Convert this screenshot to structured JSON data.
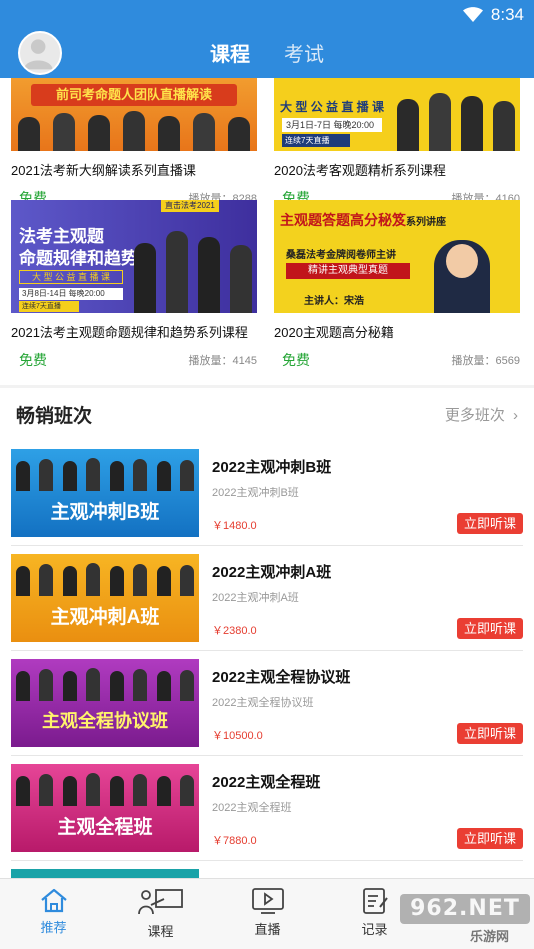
{
  "status": {
    "time": "8:34"
  },
  "header": {
    "tabs": [
      {
        "label": "课程",
        "active": true
      },
      {
        "label": "考试",
        "active": false
      }
    ]
  },
  "courses": [
    {
      "banner_text": "前司考命题人团队直播解读",
      "banner_sub": "",
      "title": "2021法考新大纲解读系列直播课",
      "price": "免费",
      "plays": "播放量：8288"
    },
    {
      "banner_text": "大 型 公 益 直 播 课",
      "banner_sub": "3月1日-7日 每晚20:00",
      "banner_sub2": "连续7天直播",
      "title": "2020法考客观题精析系列课程",
      "price": "免费",
      "plays": "播放量：4160"
    },
    {
      "banner_tag": "直击法考2021",
      "banner_text": "法考主观题",
      "banner_text2": "命题规律和趋势",
      "banner_sub": "大 型 公 益 直 播 课",
      "banner_date": "3月8日-14日 每晚20:00",
      "banner_date2": "连续7天直播",
      "title": "2021法考主观题命题规律和趋势系列课程",
      "price": "免费",
      "plays": "播放量：4145"
    },
    {
      "banner_text": "主观题答题高分秘笈",
      "banner_suffix": "系列讲座",
      "banner_sub": "桑磊法考金牌阅卷师主讲",
      "banner_sub2": "精讲主观典型真题",
      "banner_speaker": "主讲人：宋浩",
      "title": "2020主观题高分秘籍",
      "price": "免费",
      "plays": "播放量：6569"
    }
  ],
  "bestseller": {
    "title": "畅销班次",
    "more": "更多班次",
    "items": [
      {
        "banner": "主观冲刺B班",
        "title": "2022主观冲刺B班",
        "subtitle": "2022主观冲刺B班",
        "price": "￥1480.0",
        "button": "立即听课",
        "color": "#1f8fd6"
      },
      {
        "banner": "主观冲刺A班",
        "title": "2022主观冲刺A班",
        "subtitle": "2022主观冲刺A班",
        "price": "￥2380.0",
        "button": "立即听课",
        "color": "#f2a517"
      },
      {
        "banner": "主观全程协议班",
        "title": "2022主观全程协议班",
        "subtitle": "2022主观全程协议班",
        "price": "￥10500.0",
        "button": "立即听课",
        "color": "#9b2aa8"
      },
      {
        "banner": "主观全程班",
        "title": "2022主观全程班",
        "subtitle": "2022主观全程班",
        "price": "￥7880.0",
        "button": "立即听课",
        "color": "#d6287a"
      }
    ]
  },
  "nav": [
    {
      "label": "推荐",
      "icon": "home-icon",
      "active": true
    },
    {
      "label": "课程",
      "icon": "class-icon",
      "active": false
    },
    {
      "label": "直播",
      "icon": "live-icon",
      "active": false
    },
    {
      "label": "记录",
      "icon": "record-icon",
      "active": false
    }
  ],
  "watermark": {
    "text": "962.NET",
    "sub": "乐游网"
  }
}
